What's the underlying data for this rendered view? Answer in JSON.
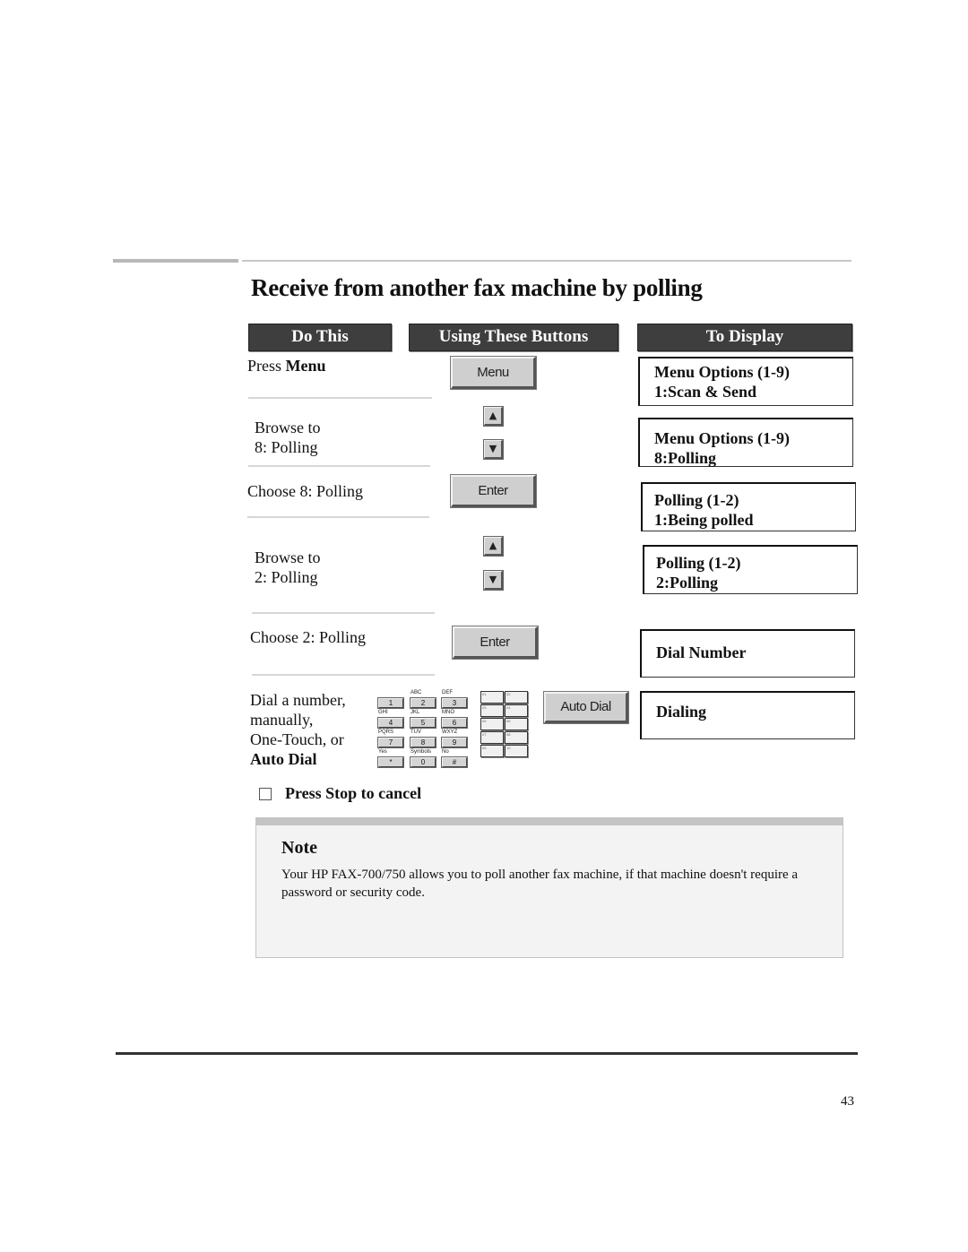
{
  "page": {
    "title": "Receive from another fax machine by polling",
    "page_number": "43"
  },
  "columns": {
    "do_this": "Do This",
    "using_buttons": "Using These Buttons",
    "to_display": "To Display"
  },
  "steps": [
    {
      "text_prefix": "Press ",
      "text_bold": "Menu",
      "button": "Menu",
      "display": [
        "Menu Options (1-9)",
        "1:Scan & Send"
      ]
    },
    {
      "line1": "Browse to",
      "line2": "8: Polling",
      "buttons": [
        "up-arrow",
        "down-arrow"
      ],
      "display": [
        "Menu Options (1-9)",
        "8:Polling"
      ]
    },
    {
      "text": "Choose 8: Polling",
      "button": "Enter",
      "display": [
        "Polling (1-2)",
        "1:Being polled"
      ]
    },
    {
      "line1": "Browse to",
      "line2": "2: Polling",
      "buttons": [
        "up-arrow",
        "down-arrow"
      ],
      "display": [
        "Polling (1-2)",
        "2:Polling"
      ]
    },
    {
      "text": "Choose 2: Polling",
      "button": "Enter",
      "display": [
        "Dial Number"
      ]
    },
    {
      "lines": [
        "Dial a number,",
        "manually,",
        "One-Touch, or"
      ],
      "line_bold": "Auto Dial",
      "button": "Auto Dial",
      "display": [
        "Dialing"
      ]
    }
  ],
  "icons": {
    "up": "▲",
    "down": "▼"
  },
  "keypad": {
    "keys": [
      {
        "key": "1",
        "label": ""
      },
      {
        "key": "2",
        "label": "ABC"
      },
      {
        "key": "3",
        "label": "DEF"
      },
      {
        "key": "4",
        "label": "GHI"
      },
      {
        "key": "5",
        "label": "JKL"
      },
      {
        "key": "6",
        "label": "MNO"
      },
      {
        "key": "7",
        "label": "PQRS"
      },
      {
        "key": "8",
        "label": "TUV"
      },
      {
        "key": "9",
        "label": "WXYZ"
      },
      {
        "key": "*",
        "label": "Yes"
      },
      {
        "key": "0",
        "label": "Symbols"
      },
      {
        "key": "#",
        "label": "No"
      }
    ]
  },
  "onetouch": {
    "keys": [
      "01",
      "02",
      "03",
      "04",
      "05",
      "06",
      "07",
      "08",
      "09",
      "10"
    ]
  },
  "cancel": {
    "text": "Press Stop to cancel"
  },
  "note": {
    "title": "Note",
    "body": "Your HP FAX-700/750 allows you to poll another fax machine, if that machine doesn't require a password or security code."
  }
}
